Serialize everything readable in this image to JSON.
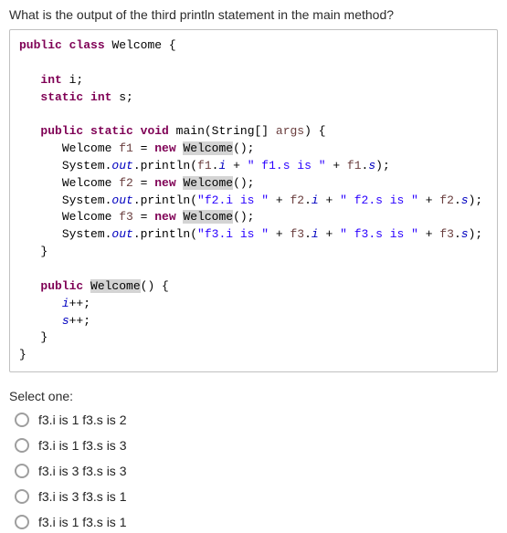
{
  "question": "What is the output of the third println statement in the main method?",
  "code": {
    "l1a": "public",
    "l1b": "class",
    "l1c": " Welcome {",
    "l2a": "int",
    "l2b": " i;",
    "l3a": "static",
    "l3b": "int",
    "l3c": " s;",
    "l4a": "public",
    "l4b": "static",
    "l4c": "void",
    "l4d": " main(String[] ",
    "l4e": "args",
    "l4f": ") {",
    "l5a": "Welcome ",
    "l5b": "f1",
    "l5c": " = ",
    "l5d": "new",
    "l5e": "Welcome",
    "l5f": "();",
    "l6a": "System.",
    "l6b": "out",
    "l6c": ".println(",
    "l6d": "f1",
    "l6e": ".",
    "l6f": "i",
    "l6g": " + ",
    "l6h": "\" f1.s is \"",
    "l6i": " + ",
    "l6j": "f1",
    "l6k": ".",
    "l6l": "s",
    "l6m": ");",
    "l7a": "Welcome ",
    "l7b": "f2",
    "l7c": " = ",
    "l7d": "new",
    "l7e": "Welcome",
    "l7f": "();",
    "l8a": "System.",
    "l8b": "out",
    "l8c": ".println(",
    "l8d": "\"f2.i is \"",
    "l8e": " + ",
    "l8f": "f2",
    "l8g": ".",
    "l8h": "i",
    "l8i": " + ",
    "l8j": "\" f2.s is \"",
    "l8k": " + ",
    "l8l": "f2",
    "l8m": ".",
    "l8n": "s",
    "l8o": ");",
    "l9a": "Welcome ",
    "l9b": "f3",
    "l9c": " = ",
    "l9d": "new",
    "l9e": "Welcome",
    "l9f": "();",
    "l10a": "System.",
    "l10b": "out",
    "l10c": ".println(",
    "l10d": "\"f3.i is \"",
    "l10e": " + ",
    "l10f": "f3",
    "l10g": ".",
    "l10h": "i",
    "l10i": " + ",
    "l10j": "\" f3.s is \"",
    "l10k": " + ",
    "l10l": "f3",
    "l10m": ".",
    "l10n": "s",
    "l10o": ");",
    "l11": "}",
    "l12a": "public",
    "l12b": "Welcome",
    "l12c": "() {",
    "l13a": "i",
    "l13b": "++;",
    "l14a": "s",
    "l14b": "++;",
    "l15": "}",
    "l16": "}"
  },
  "select_label": "Select one:",
  "options": [
    "f3.i is 1 f3.s is 2",
    "f3.i is 1 f3.s is 3",
    "f3.i is 3 f3.s is 3",
    "f3.i is 3 f3.s is 1",
    "f3.i is 1 f3.s is 1"
  ]
}
